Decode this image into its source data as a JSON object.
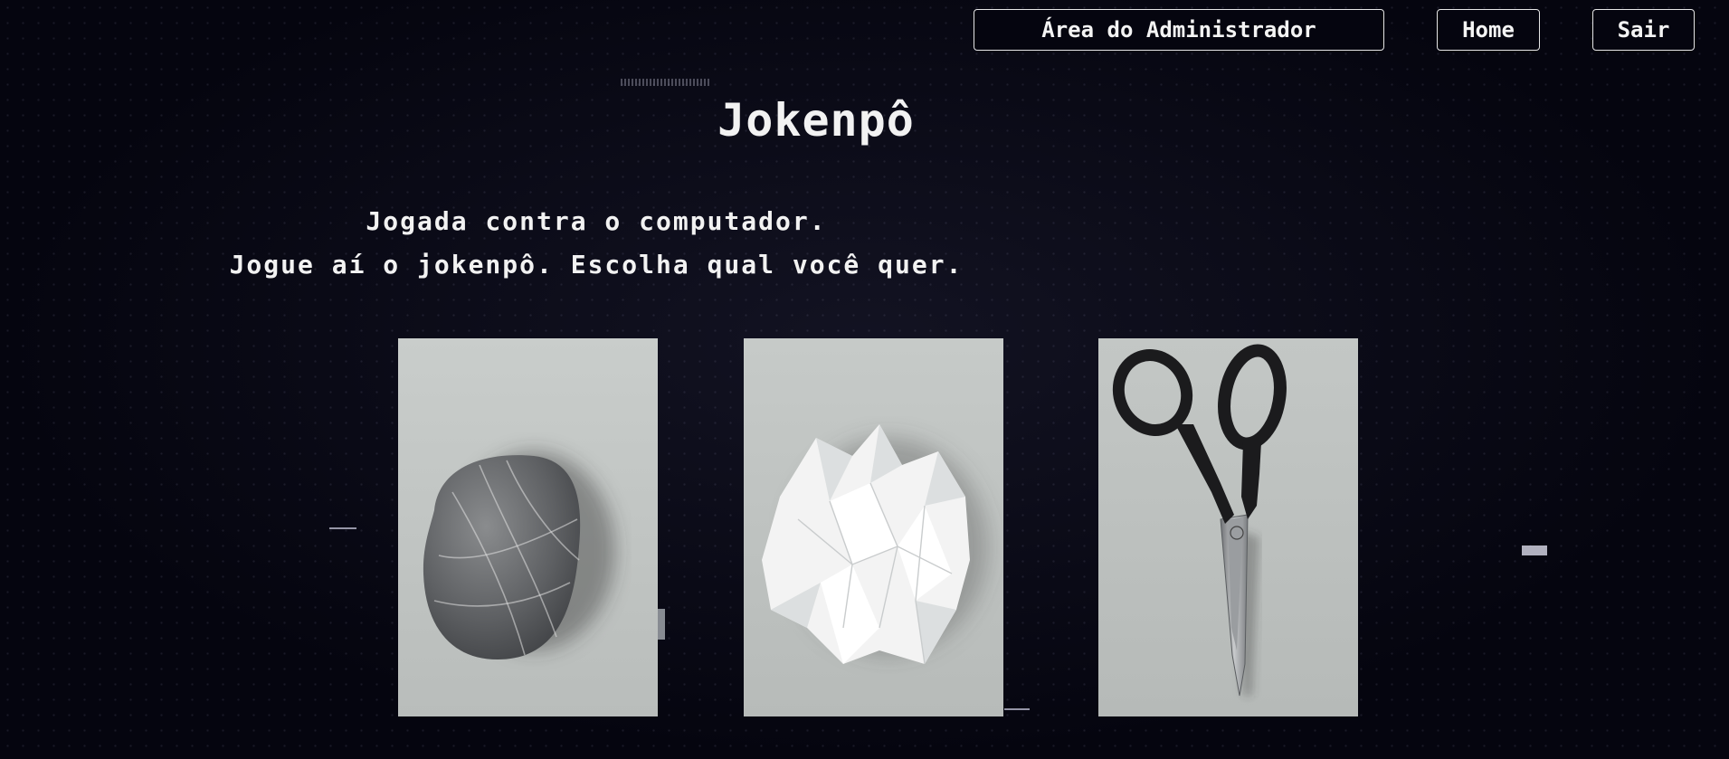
{
  "nav": {
    "admin_label": "Área do Administrador",
    "home_label": "Home",
    "logout_label": "Sair"
  },
  "main": {
    "title": "Jokenpô",
    "subtitle_line1": "Jogada contra o computador.",
    "subtitle_line2": "Jogue aí o jokenpô. Escolha qual você quer."
  },
  "choices": [
    {
      "name": "rock",
      "icon": "rock-image"
    },
    {
      "name": "paper",
      "icon": "crumpled-paper-image"
    },
    {
      "name": "scissors",
      "icon": "scissors-image"
    }
  ],
  "colors": {
    "background": "#05050f",
    "text": "#f2f2f2",
    "card_background": "#c6cac8"
  }
}
